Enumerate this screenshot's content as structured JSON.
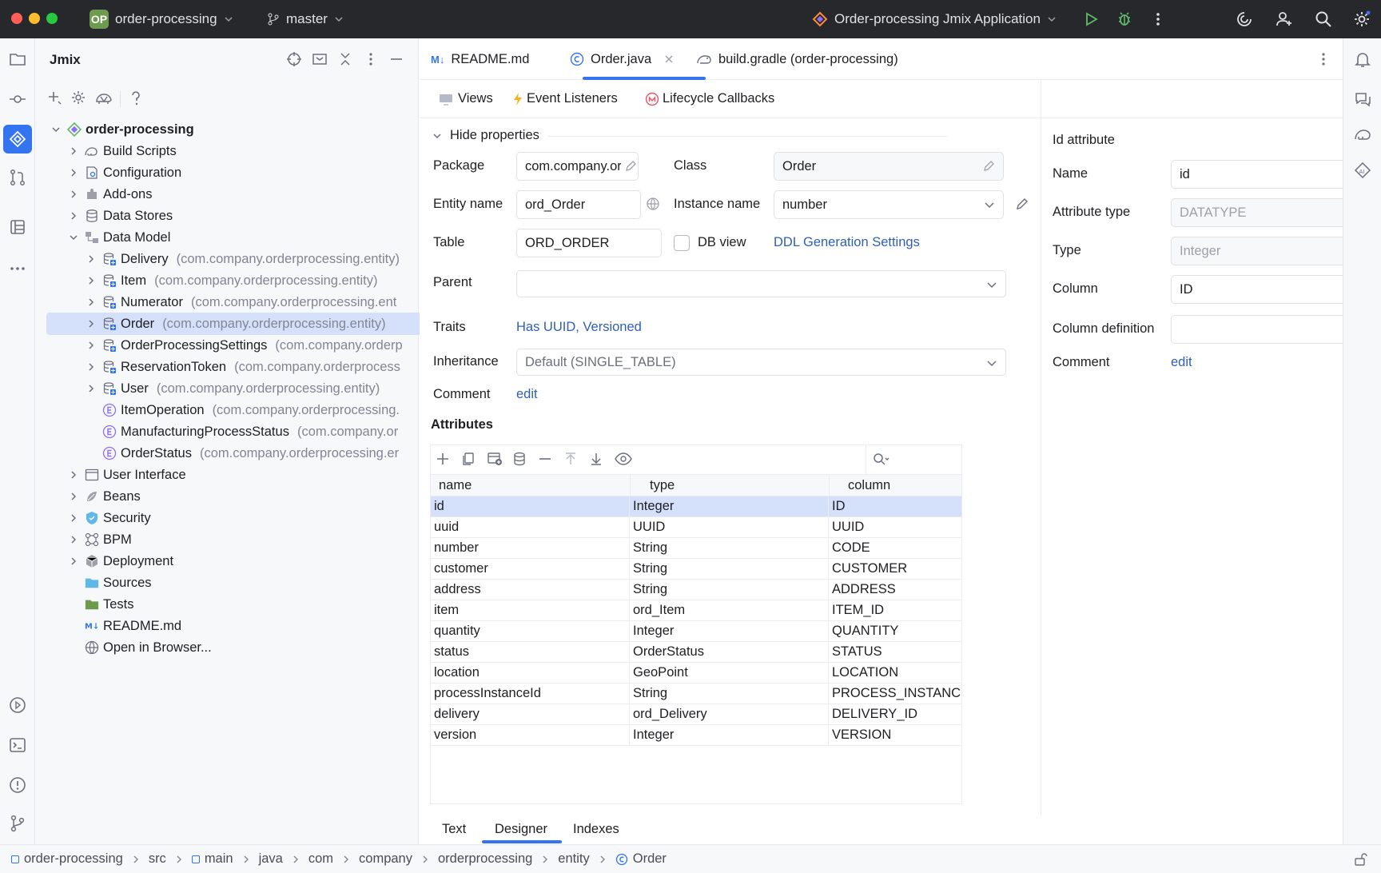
{
  "titlebar": {
    "project_badge": "OP",
    "project_name": "order-processing",
    "branch": "master",
    "run_config": "Order-processing Jmix Application"
  },
  "project_panel": {
    "title": "Jmix",
    "tree": [
      {
        "label": "order-processing",
        "bold": true,
        "level": 0,
        "icon": "project-icon",
        "expanded": true
      },
      {
        "label": "Build Scripts",
        "level": 1,
        "icon": "gradle-icon",
        "chevron": true
      },
      {
        "label": "Configuration",
        "level": 1,
        "icon": "config-icon",
        "chevron": true
      },
      {
        "label": "Add-ons",
        "level": 1,
        "icon": "addon-icon",
        "chevron": true
      },
      {
        "label": "Data Stores",
        "level": 1,
        "icon": "database-icon",
        "chevron": true
      },
      {
        "label": "Data Model",
        "level": 1,
        "icon": "data-model-icon",
        "chevron": true,
        "expanded": true
      },
      {
        "label": "Delivery",
        "pkg": "(com.company.orderprocessing.entity)",
        "level": 2,
        "icon": "entity-icon",
        "chevron": true
      },
      {
        "label": "Item",
        "pkg": "(com.company.orderprocessing.entity)",
        "level": 2,
        "icon": "entity-icon",
        "chevron": true
      },
      {
        "label": "Numerator",
        "pkg": "(com.company.orderprocessing.ent",
        "level": 2,
        "icon": "entity-icon",
        "chevron": true
      },
      {
        "label": "Order",
        "pkg": "(com.company.orderprocessing.entity)",
        "level": 2,
        "icon": "entity-icon",
        "chevron": true,
        "selected": true
      },
      {
        "label": "OrderProcessingSettings",
        "pkg": "(com.company.orderp",
        "level": 2,
        "icon": "entity-icon",
        "chevron": true
      },
      {
        "label": "ReservationToken",
        "pkg": "(com.company.orderprocess",
        "level": 2,
        "icon": "entity-icon",
        "chevron": true
      },
      {
        "label": "User",
        "pkg": "(com.company.orderprocessing.entity)",
        "level": 2,
        "icon": "entity-icon",
        "chevron": true
      },
      {
        "label": "ItemOperation",
        "pkg": "(com.company.orderprocessing.",
        "level": 2,
        "icon": "enum-icon"
      },
      {
        "label": "ManufacturingProcessStatus",
        "pkg": "(com.company.or",
        "level": 2,
        "icon": "enum-icon"
      },
      {
        "label": "OrderStatus",
        "pkg": "(com.company.orderprocessing.er",
        "level": 2,
        "icon": "enum-icon"
      },
      {
        "label": "User Interface",
        "level": 1,
        "icon": "ui-icon",
        "chevron": true
      },
      {
        "label": "Beans",
        "level": 1,
        "icon": "beans-icon",
        "chevron": true
      },
      {
        "label": "Security",
        "level": 1,
        "icon": "shield-icon",
        "chevron": true
      },
      {
        "label": "BPM",
        "level": 1,
        "icon": "bpm-icon",
        "chevron": true
      },
      {
        "label": "Deployment",
        "level": 1,
        "icon": "deployment-icon",
        "chevron": true
      },
      {
        "label": "Sources",
        "level": 1,
        "icon": "sources-folder-icon"
      },
      {
        "label": "Tests",
        "level": 1,
        "icon": "tests-folder-icon"
      },
      {
        "label": "README.md",
        "level": 1,
        "icon": "markdown-icon"
      },
      {
        "label": "Open in Browser...",
        "level": 1,
        "icon": "globe-icon"
      }
    ]
  },
  "tabs": [
    {
      "label": "README.md",
      "icon": "markdown-icon",
      "active": false
    },
    {
      "label": "Order.java",
      "icon": "class-icon",
      "active": true
    },
    {
      "label": "build.gradle (order-processing)",
      "icon": "gradle-icon",
      "active": false
    }
  ],
  "designer_toolbar": {
    "views": "Views",
    "event_listeners": "Event Listeners",
    "lifecycle_callbacks": "Lifecycle Callbacks"
  },
  "properties": {
    "toggle_label": "Hide properties",
    "package_label": "Package",
    "package_value": "com.company.ord",
    "class_label": "Class",
    "class_value": "Order",
    "entity_name_label": "Entity name",
    "entity_name_value": "ord_Order",
    "instance_name_label": "Instance name",
    "instance_name_value": "number",
    "table_label": "Table",
    "table_value": "ORD_ORDER",
    "db_view_label": "DB view",
    "ddl_link": "DDL Generation Settings",
    "parent_label": "Parent",
    "parent_value": "",
    "traits_label": "Traits",
    "traits_value": "Has UUID, Versioned",
    "inheritance_label": "Inheritance",
    "inheritance_value": "Default (SINGLE_TABLE)",
    "comment_label": "Comment",
    "comment_link": "edit"
  },
  "attributes": {
    "title": "Attributes",
    "headers": [
      "name",
      "type",
      "column"
    ],
    "rows": [
      [
        "id",
        "Integer",
        "ID"
      ],
      [
        "uuid",
        "UUID",
        "UUID"
      ],
      [
        "number",
        "String",
        "CODE"
      ],
      [
        "customer",
        "String",
        "CUSTOMER"
      ],
      [
        "address",
        "String",
        "ADDRESS"
      ],
      [
        "item",
        "ord_Item",
        "ITEM_ID"
      ],
      [
        "quantity",
        "Integer",
        "QUANTITY"
      ],
      [
        "status",
        "OrderStatus",
        "STATUS"
      ],
      [
        "location",
        "GeoPoint",
        "LOCATION"
      ],
      [
        "processInstanceId",
        "String",
        "PROCESS_INSTANCE_ID"
      ],
      [
        "delivery",
        "ord_Delivery",
        "DELIVERY_ID"
      ],
      [
        "version",
        "Integer",
        "VERSION"
      ]
    ]
  },
  "bottom_tabs": [
    {
      "label": "Text",
      "active": false
    },
    {
      "label": "Designer",
      "active": true
    },
    {
      "label": "Indexes",
      "active": false
    }
  ],
  "id_attribute": {
    "title": "Id attribute",
    "name_label": "Name",
    "name_value": "id",
    "attribute_type_label": "Attribute type",
    "attribute_type_value": "DATATYPE",
    "type_label": "Type",
    "type_value": "Integer",
    "column_label": "Column",
    "column_value": "ID",
    "column_definition_label": "Column definition",
    "column_definition_value": "",
    "comment_label": "Comment",
    "comment_link": "edit"
  },
  "breadcrumbs": [
    "order-processing",
    "src",
    "main",
    "java",
    "com",
    "company",
    "orderprocessing",
    "entity",
    "Order"
  ],
  "colors": {
    "accent": "#3574f0",
    "link": "#2f5fb3",
    "selection": "#d5e1fb",
    "titlebar": "#27282c"
  }
}
